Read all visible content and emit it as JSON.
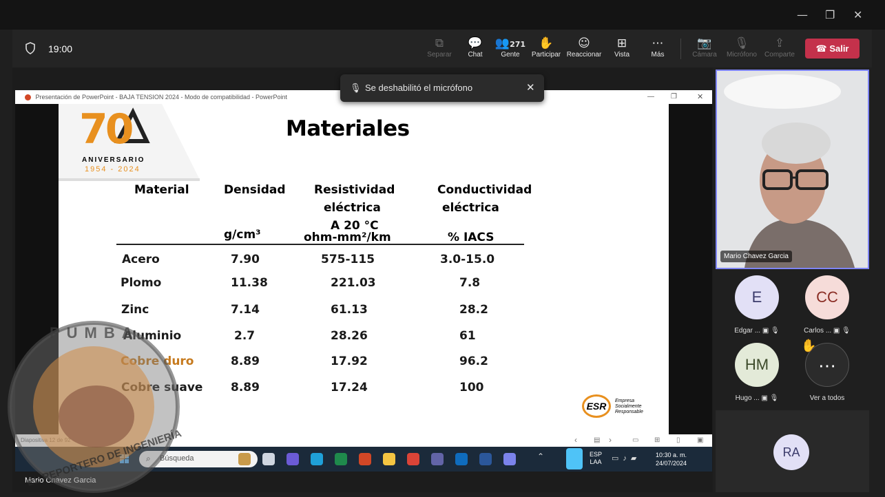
{
  "meeting": {
    "timer": "19:00",
    "toolbar": [
      {
        "label": "Separar",
        "icon": "pop-out-icon",
        "disabled": true
      },
      {
        "label": "Chat",
        "icon": "chat-icon",
        "disabled": false
      },
      {
        "label": "Gente",
        "icon": "people-icon",
        "count": "271",
        "disabled": false
      },
      {
        "label": "Participar",
        "icon": "raise-hand-icon",
        "disabled": false
      },
      {
        "label": "Reaccionar",
        "icon": "react-icon",
        "disabled": false
      },
      {
        "label": "Vista",
        "icon": "view-icon",
        "disabled": false
      },
      {
        "label": "Más",
        "icon": "more-icon",
        "disabled": false
      },
      {
        "label": "Cámara",
        "icon": "camera-off-icon",
        "disabled": true
      },
      {
        "label": "Micrófono",
        "icon": "mic-off-icon",
        "disabled": true
      },
      {
        "label": "Comparte",
        "icon": "share-icon",
        "disabled": true
      }
    ],
    "leave_label": "Salir",
    "toast": "Se deshabilitó el micrófono",
    "presenter_name": "Mario Chavez Garcia",
    "video_name": "Mario Chavez Garcia",
    "participants": [
      {
        "initials": "E",
        "name": "Edgar ...",
        "bg": "#e2e0f6",
        "fg": "#3b3b6b"
      },
      {
        "initials": "CC",
        "name": "Carlos ...",
        "bg": "#f6dcd9",
        "fg": "#8a2d24"
      },
      {
        "initials": "HM",
        "name": "Hugo ...",
        "bg": "#e3ead8",
        "fg": "#3c4a2a"
      },
      {
        "initials": "",
        "name": "Ver a todos",
        "bg": "#2b2b2b",
        "fg": "#ffffff"
      }
    ],
    "ra_initials": "RA"
  },
  "powerpoint": {
    "title_bar": "Presentación de PowerPoint  -  BAJA TENSION  2024  -  Modo de compatibilidad  -  PowerPoint",
    "status": "Diapositiva 12 de 92"
  },
  "slide": {
    "title": "Materiales",
    "logo_number": "70",
    "logo_text": "ANIVERSARIO",
    "logo_years": "1954 - 2024",
    "headers": {
      "material": "Material",
      "density": "Densidad",
      "density_unit": "g/cm³",
      "resistivity": "Resistividad",
      "resistivity2": "eléctrica",
      "resistivity_temp": "A 20 °C",
      "resistivity_unit": "ohm-mm²/km",
      "conductivity": "Conductividad",
      "conductivity2": "eléctrica",
      "conductivity_unit": "% IACS"
    },
    "rows": [
      {
        "material": "Acero",
        "density": "7.90",
        "resistivity": "575-115",
        "conductivity": "3.0-15.0",
        "orange": false
      },
      {
        "material": "Plomo",
        "density": "11.38",
        "resistivity": "221.03",
        "conductivity": "7.8",
        "orange": false
      },
      {
        "material": "Zinc",
        "density": "7.14",
        "resistivity": "61.13",
        "conductivity": "28.2",
        "orange": false
      },
      {
        "material": "Aluminio",
        "density": "2.7",
        "resistivity": "28.26",
        "conductivity": "61",
        "orange": false
      },
      {
        "material": "Cobre duro",
        "density": "8.89",
        "resistivity": "17.92",
        "conductivity": "96.2",
        "orange": true
      },
      {
        "material": "Cobre suave",
        "density": "8.89",
        "resistivity": "17.24",
        "conductivity": "100",
        "orange": false
      }
    ],
    "esr": "ESR",
    "esr_text": "Empresa Socialmente Responsable"
  },
  "taskbar": {
    "search_placeholder": "Búsqueda",
    "lang": "ESP",
    "lang2": "LAA",
    "time": "10:30 a. m.",
    "date": "24/07/2024"
  },
  "watermark": {
    "top": "PUMBA",
    "bottom": "EL REPORTERO DE INGENIERÍA"
  }
}
